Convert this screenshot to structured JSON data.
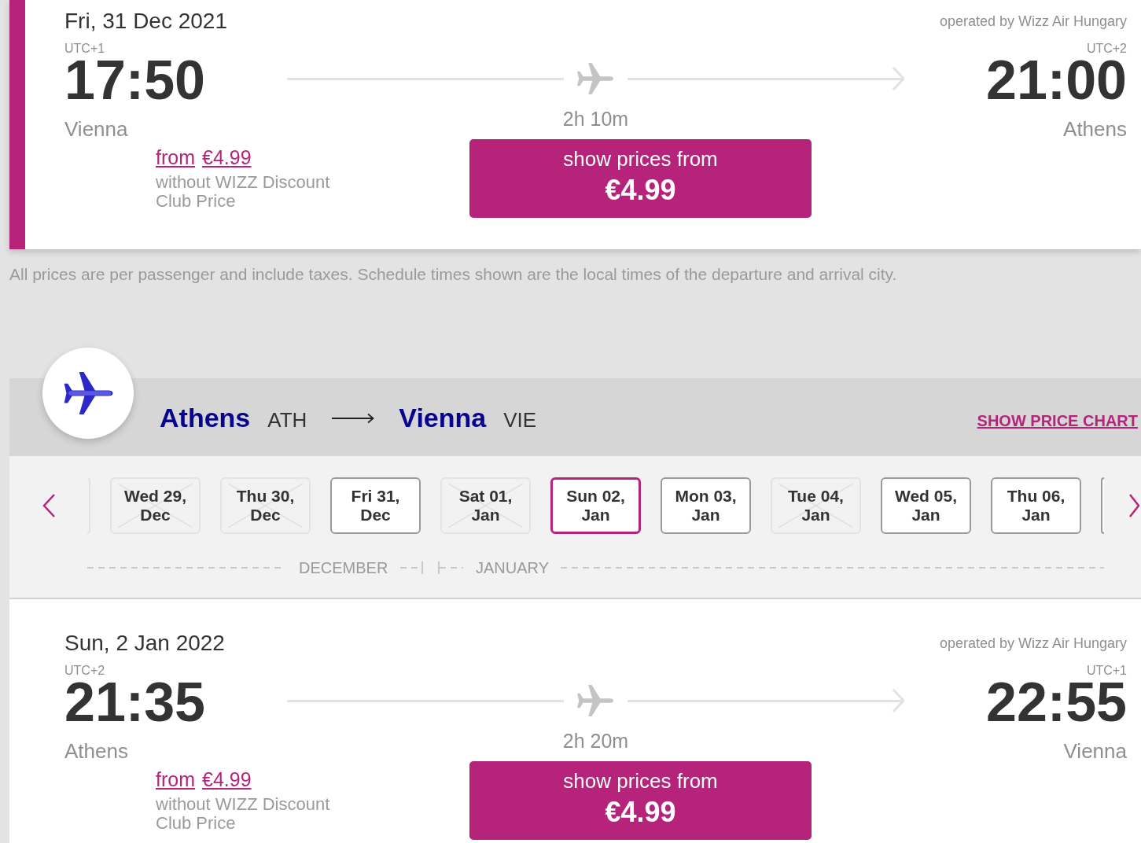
{
  "outbound": {
    "flight": {
      "selected": true,
      "date": "Fri, 31 Dec 2021",
      "operator": "operated by Wizz Air Hungary",
      "departure": {
        "utc": "UTC+1",
        "time": "17:50",
        "city": "Vienna"
      },
      "arrival": {
        "utc": "UTC+2",
        "time": "21:00",
        "city": "Athens"
      },
      "duration": "2h 10m",
      "from_label": "from",
      "from_price": "€4.99",
      "price_note": "without WIZZ Discount Club Price",
      "button": {
        "label": "show prices from",
        "price": "€4.99"
      }
    }
  },
  "note": "All prices are per passenger and include taxes. Schedule times shown are the local times of the departure and arrival city.",
  "return": {
    "route": {
      "origin": {
        "city": "Athens",
        "code": "ATH"
      },
      "destination": {
        "city": "Vienna",
        "code": "VIE"
      }
    },
    "price_chart_link": "SHOW PRICE CHART",
    "date_strip": {
      "partial_before": {
        "disabled": true
      },
      "dates": [
        {
          "label": "Wed 29, Dec",
          "disabled": true,
          "selected": false
        },
        {
          "label": "Thu 30, Dec",
          "disabled": true,
          "selected": false
        },
        {
          "label": "Fri 31, Dec",
          "disabled": false,
          "selected": false
        },
        {
          "label": "Sat 01, Jan",
          "disabled": true,
          "selected": false
        },
        {
          "label": "Sun 02, Jan",
          "disabled": false,
          "selected": true
        },
        {
          "label": "Mon 03, Jan",
          "disabled": false,
          "selected": false
        },
        {
          "label": "Tue 04, Jan",
          "disabled": true,
          "selected": false
        },
        {
          "label": "Wed 05, Jan",
          "disabled": false,
          "selected": false
        },
        {
          "label": "Thu 06, Jan",
          "disabled": false,
          "selected": false
        }
      ],
      "partial_after": {
        "disabled": false
      },
      "months": [
        "DECEMBER",
        "JANUARY"
      ]
    },
    "flight": {
      "selected": false,
      "date": "Sun, 2 Jan 2022",
      "operator": "operated by Wizz Air Hungary",
      "departure": {
        "utc": "UTC+2",
        "time": "21:35",
        "city": "Athens"
      },
      "arrival": {
        "utc": "UTC+1",
        "time": "22:55",
        "city": "Vienna"
      },
      "duration": "2h 20m",
      "from_label": "from",
      "from_price": "€4.99",
      "price_note": "without WIZZ Discount Club Price",
      "button": {
        "label": "show prices from",
        "price": "€4.99"
      }
    }
  }
}
